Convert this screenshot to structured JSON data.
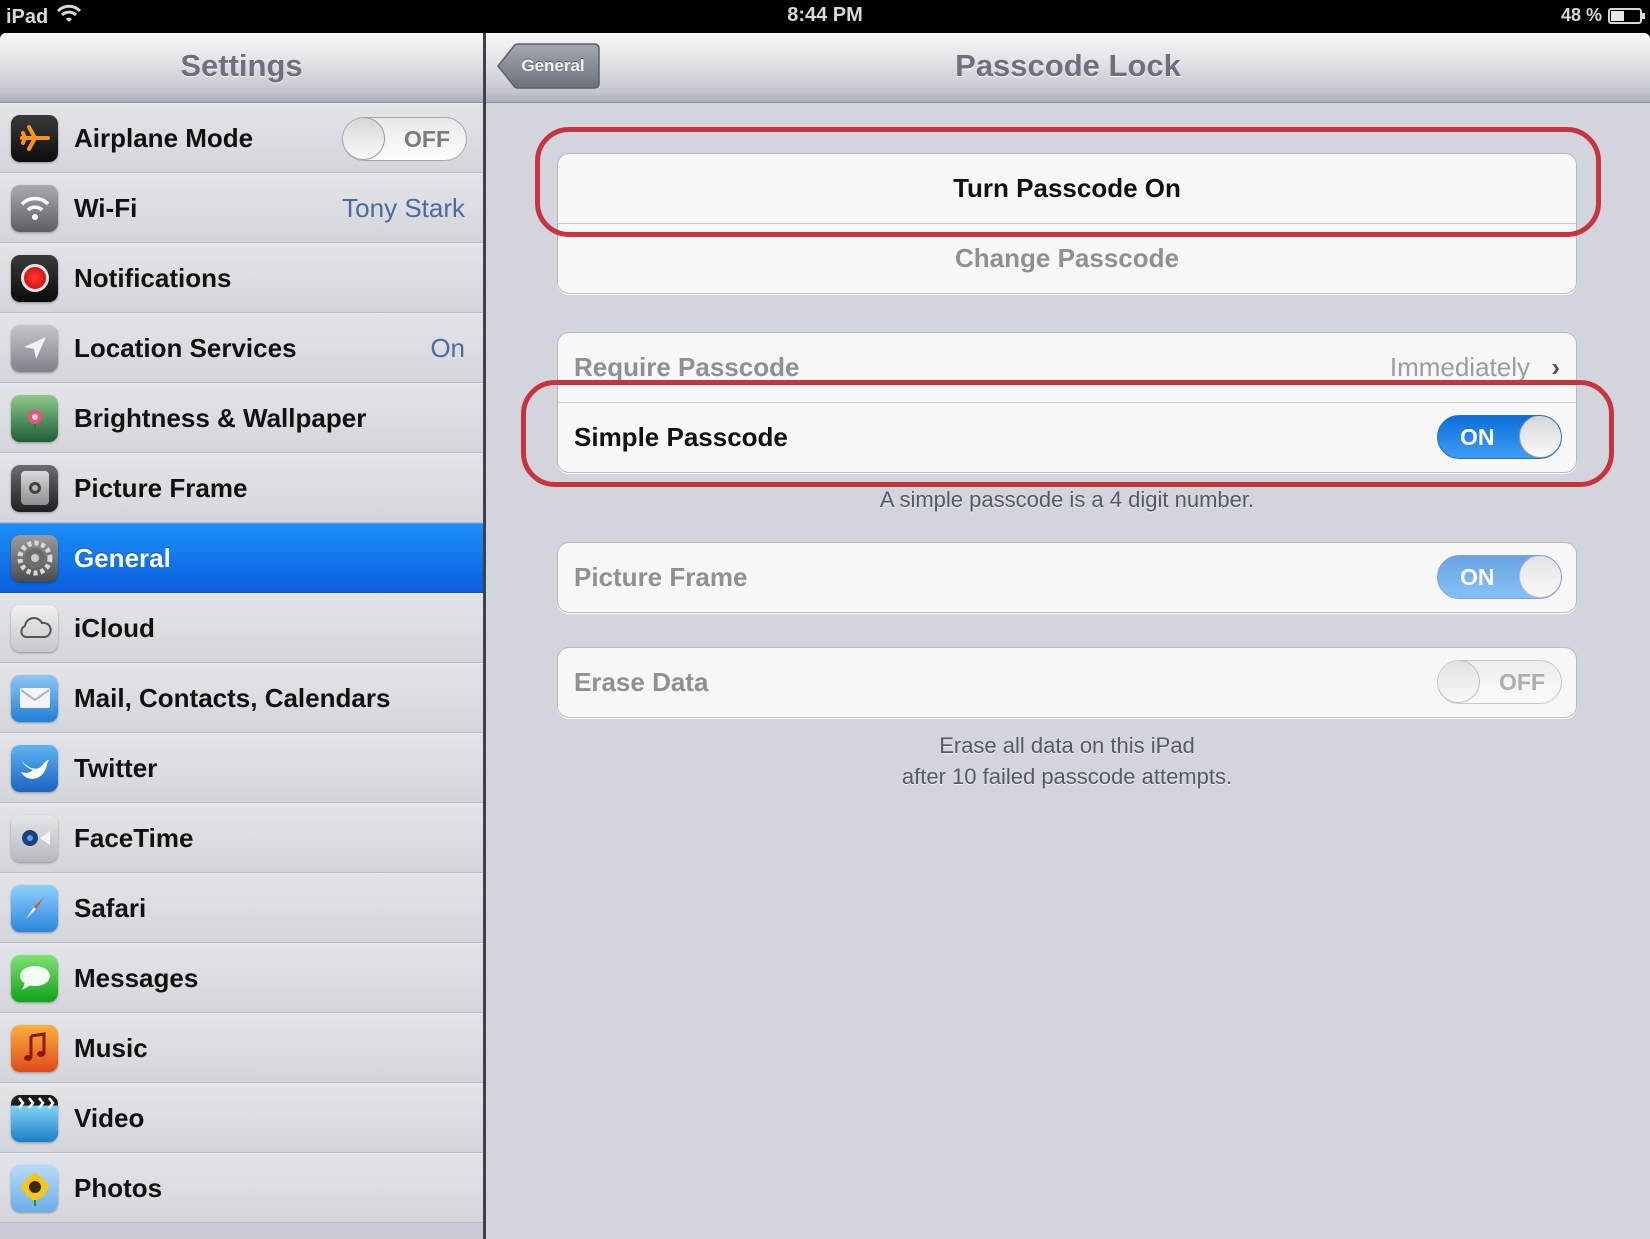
{
  "status_bar": {
    "device": "iPad",
    "time": "8:44 PM",
    "battery_text": "48 %",
    "battery_level": 0.48
  },
  "sidebar": {
    "title": "Settings",
    "items": [
      {
        "label": "Airplane Mode",
        "icon": "airplane-icon",
        "toggle": "OFF"
      },
      {
        "label": "Wi-Fi",
        "icon": "wifi-icon",
        "value": "Tony Stark"
      },
      {
        "label": "Notifications",
        "icon": "notifications-icon"
      },
      {
        "label": "Location Services",
        "icon": "location-icon",
        "value": "On"
      },
      {
        "label": "Brightness & Wallpaper",
        "icon": "brightness-wallpaper-icon"
      },
      {
        "label": "Picture Frame",
        "icon": "picture-frame-icon"
      },
      {
        "label": "General",
        "icon": "gear-icon",
        "selected": true
      },
      {
        "label": "iCloud",
        "icon": "cloud-icon"
      },
      {
        "label": "Mail, Contacts, Calendars",
        "icon": "mail-icon"
      },
      {
        "label": "Twitter",
        "icon": "twitter-bird-icon"
      },
      {
        "label": "FaceTime",
        "icon": "facetime-camera-icon"
      },
      {
        "label": "Safari",
        "icon": "compass-icon"
      },
      {
        "label": "Messages",
        "icon": "speech-bubble-icon"
      },
      {
        "label": "Music",
        "icon": "music-note-icon"
      },
      {
        "label": "Video",
        "icon": "clapperboard-icon"
      },
      {
        "label": "Photos",
        "icon": "sunflower-icon"
      }
    ]
  },
  "main": {
    "back_label": "General",
    "title": "Passcode Lock",
    "group1": {
      "turn_on": "Turn Passcode On",
      "change": "Change Passcode"
    },
    "group2": {
      "require_label": "Require Passcode",
      "require_value": "Immediately",
      "simple_label": "Simple Passcode",
      "simple_toggle": "ON",
      "footnote": "A simple passcode is a 4 digit number."
    },
    "group3": {
      "label": "Picture Frame",
      "toggle": "ON"
    },
    "group4": {
      "label": "Erase Data",
      "toggle": "OFF",
      "footnote_line1": "Erase all data on this iPad",
      "footnote_line2": "after 10 failed passcode attempts."
    }
  },
  "colors": {
    "selection_blue": "#0a5fe0",
    "toggle_on": "#1e7fe8",
    "annotation_red": "#c7343f",
    "detail_blue": "#4b6b9a"
  }
}
